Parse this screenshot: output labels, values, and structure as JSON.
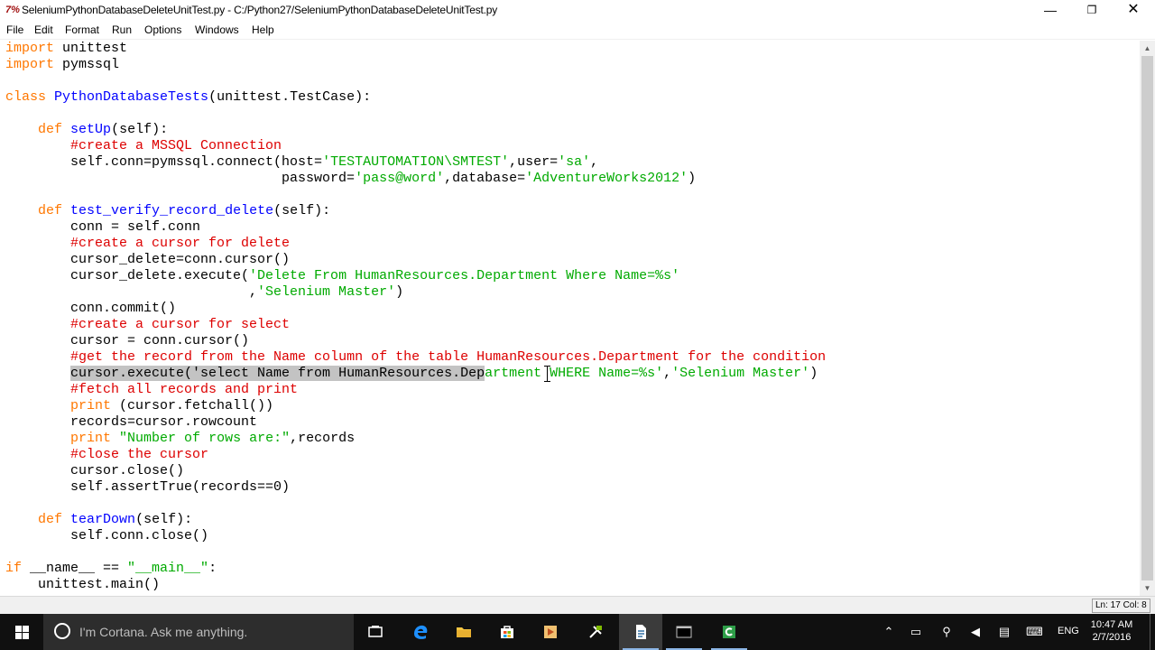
{
  "window": {
    "title": "SeleniumPythonDatabaseDeleteUnitTest.py - C:/Python27/SeleniumPythonDatabaseDeleteUnitTest.py",
    "app_icon": "7%",
    "buttons": {
      "minimize": "—",
      "maximize": "❐",
      "close": "✕"
    }
  },
  "menu": {
    "items": [
      "File",
      "Edit",
      "Format",
      "Run",
      "Options",
      "Windows",
      "Help"
    ]
  },
  "editor": {
    "lines": [
      [
        {
          "t": "import",
          "c": "kw"
        },
        {
          "t": " unittest",
          "c": "plain"
        }
      ],
      [
        {
          "t": "import",
          "c": "kw"
        },
        {
          "t": " pymssql",
          "c": "plain"
        }
      ],
      [],
      [
        {
          "t": "class",
          "c": "kw"
        },
        {
          "t": " ",
          "c": "plain"
        },
        {
          "t": "PythonDatabaseTests",
          "c": "def"
        },
        {
          "t": "(unittest.TestCase):",
          "c": "plain"
        }
      ],
      [],
      [
        {
          "t": "    ",
          "c": "plain"
        },
        {
          "t": "def",
          "c": "kw"
        },
        {
          "t": " ",
          "c": "plain"
        },
        {
          "t": "setUp",
          "c": "def"
        },
        {
          "t": "(self):",
          "c": "plain"
        }
      ],
      [
        {
          "t": "        ",
          "c": "plain"
        },
        {
          "t": "#create a MSSQL Connection",
          "c": "com"
        }
      ],
      [
        {
          "t": "        self.conn=pymssql.connect(host=",
          "c": "plain"
        },
        {
          "t": "'TESTAUTOMATION\\SMTEST'",
          "c": "str"
        },
        {
          "t": ",user=",
          "c": "plain"
        },
        {
          "t": "'sa'",
          "c": "str"
        },
        {
          "t": ",",
          "c": "plain"
        }
      ],
      [
        {
          "t": "                                  password=",
          "c": "plain"
        },
        {
          "t": "'pass@word'",
          "c": "str"
        },
        {
          "t": ",database=",
          "c": "plain"
        },
        {
          "t": "'AdventureWorks2012'",
          "c": "str"
        },
        {
          "t": ")",
          "c": "plain"
        }
      ],
      [],
      [
        {
          "t": "    ",
          "c": "plain"
        },
        {
          "t": "def",
          "c": "kw"
        },
        {
          "t": " ",
          "c": "plain"
        },
        {
          "t": "test_verify_record_delete",
          "c": "def"
        },
        {
          "t": "(self):",
          "c": "plain"
        }
      ],
      [
        {
          "t": "        conn = self.conn",
          "c": "plain"
        }
      ],
      [
        {
          "t": "        ",
          "c": "plain"
        },
        {
          "t": "#create a cursor for delete",
          "c": "com"
        }
      ],
      [
        {
          "t": "        cursor_delete=conn.cursor()",
          "c": "plain"
        }
      ],
      [
        {
          "t": "        cursor_delete.execute(",
          "c": "plain"
        },
        {
          "t": "'Delete From HumanResources.Department Where Name=%s'",
          "c": "str"
        }
      ],
      [
        {
          "t": "                              ,",
          "c": "plain"
        },
        {
          "t": "'Selenium Master'",
          "c": "str"
        },
        {
          "t": ")",
          "c": "plain"
        }
      ],
      [
        {
          "t": "        conn.commit()",
          "c": "plain"
        }
      ],
      [
        {
          "t": "        ",
          "c": "plain"
        },
        {
          "t": "#create a cursor for select",
          "c": "com"
        }
      ],
      [
        {
          "t": "        cursor = conn.cursor()",
          "c": "plain"
        }
      ],
      [
        {
          "t": "        ",
          "c": "plain"
        },
        {
          "t": "#get the record from the Name column of the table HumanResources.Department for the condition",
          "c": "com"
        }
      ],
      [
        {
          "t": "        ",
          "c": "plain"
        },
        {
          "t": "cursor.execute('select Name from HumanResources.Dep",
          "c": "sel"
        },
        {
          "t": "artment WHERE Name=%s'",
          "c": "str"
        },
        {
          "t": ",",
          "c": "plain"
        },
        {
          "t": "'Selenium Master'",
          "c": "str"
        },
        {
          "t": ")",
          "c": "plain"
        }
      ],
      [
        {
          "t": "        ",
          "c": "plain"
        },
        {
          "t": "#fetch all records and print",
          "c": "com"
        }
      ],
      [
        {
          "t": "        ",
          "c": "plain"
        },
        {
          "t": "print",
          "c": "kw"
        },
        {
          "t": " (cursor.fetchall())",
          "c": "plain"
        }
      ],
      [
        {
          "t": "        records=cursor.rowcount",
          "c": "plain"
        }
      ],
      [
        {
          "t": "        ",
          "c": "plain"
        },
        {
          "t": "print",
          "c": "kw"
        },
        {
          "t": " ",
          "c": "plain"
        },
        {
          "t": "\"Number of rows are:\"",
          "c": "str"
        },
        {
          "t": ",records",
          "c": "plain"
        }
      ],
      [
        {
          "t": "        ",
          "c": "plain"
        },
        {
          "t": "#close the cursor",
          "c": "com"
        }
      ],
      [
        {
          "t": "        cursor.close()",
          "c": "plain"
        }
      ],
      [
        {
          "t": "        self.assertTrue(records==0)",
          "c": "plain"
        }
      ],
      [],
      [
        {
          "t": "    ",
          "c": "plain"
        },
        {
          "t": "def",
          "c": "kw"
        },
        {
          "t": " ",
          "c": "plain"
        },
        {
          "t": "tearDown",
          "c": "def"
        },
        {
          "t": "(self):",
          "c": "plain"
        }
      ],
      [
        {
          "t": "        self.conn.close()",
          "c": "plain"
        }
      ],
      [],
      [
        {
          "t": "if",
          "c": "kw"
        },
        {
          "t": " __name__ == ",
          "c": "plain"
        },
        {
          "t": "\"__main__\"",
          "c": "str"
        },
        {
          "t": ":",
          "c": "plain"
        }
      ],
      [
        {
          "t": "    unittest.main()",
          "c": "plain"
        }
      ]
    ]
  },
  "status": {
    "position": "Ln: 17 Col: 8"
  },
  "taskbar": {
    "cortana_placeholder": "I'm Cortana. Ask me anything.",
    "language": "ENG",
    "time": "10:47 AM",
    "date": "2/7/2016"
  },
  "colors": {
    "keyword": "#ff7700",
    "definition": "#0000ff",
    "string": "#00aa00",
    "comment": "#dd0000",
    "selection": "#c3c3c3",
    "taskbar": "#101010"
  }
}
